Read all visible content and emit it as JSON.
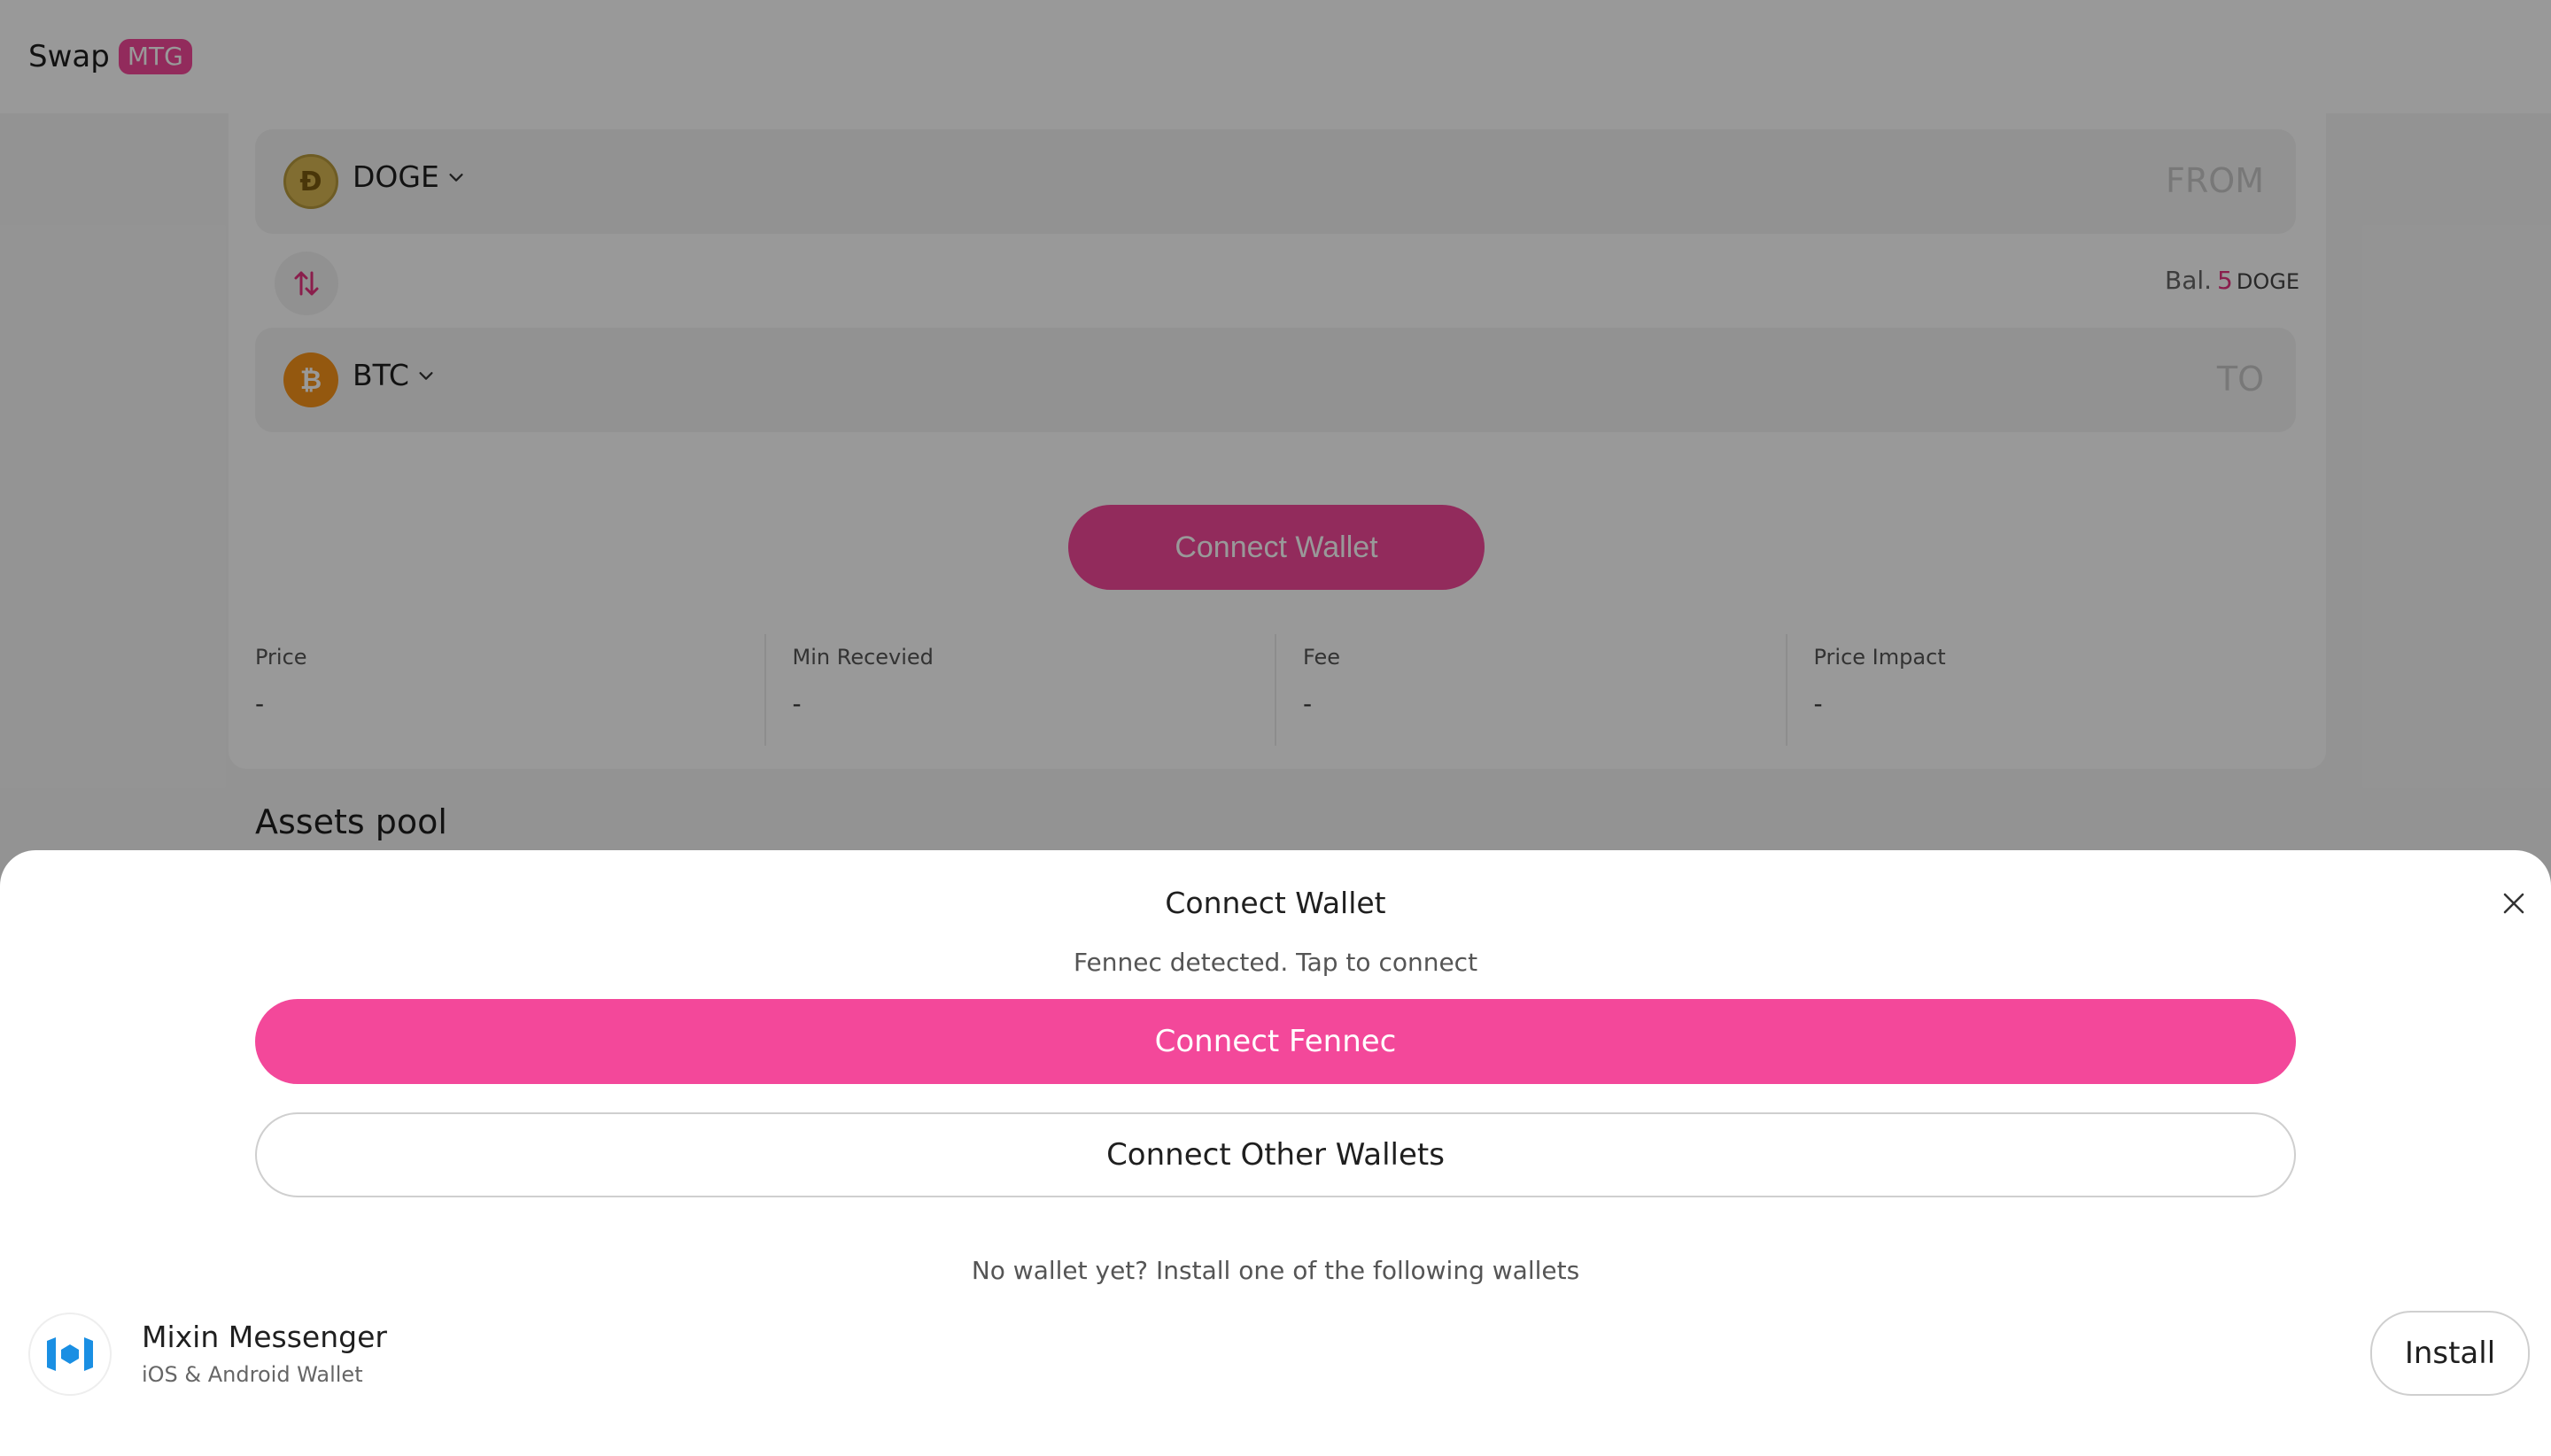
{
  "header": {
    "brand": "Swap",
    "badge": "MTG"
  },
  "swap": {
    "from": {
      "symbol": "DOGE",
      "hint": "FROM",
      "coin_glyph": "Ð"
    },
    "to": {
      "symbol": "BTC",
      "hint": "TO",
      "coin_glyph": "₿"
    },
    "balance": {
      "label": "Bal.",
      "amount": "5",
      "symbol": "DOGE"
    },
    "connect_button": "Connect Wallet",
    "stats": [
      {
        "label": "Price",
        "value": "-"
      },
      {
        "label": "Min Recevied",
        "value": "-"
      },
      {
        "label": "Fee",
        "value": "-"
      },
      {
        "label": "Price Impact",
        "value": "-"
      }
    ]
  },
  "assets_pool": {
    "title": "Assets pool"
  },
  "modal": {
    "title": "Connect Wallet",
    "detected_text": "Fennec detected. Tap to connect",
    "primary_button": "Connect Fennec",
    "secondary_button": "Connect Other Wallets",
    "install_hint": "No wallet yet? Install one of the following wallets",
    "wallets": [
      {
        "name": "Mixin Messenger",
        "subtitle": "iOS & Android Wallet",
        "action": "Install"
      }
    ]
  },
  "colors": {
    "accent": "#f3489a",
    "accent_text": "#e6337f"
  },
  "icons": [
    "doge-icon",
    "btc-icon",
    "chevron-down-icon",
    "swap-arrows-icon",
    "close-icon",
    "mixin-logo-icon"
  ]
}
